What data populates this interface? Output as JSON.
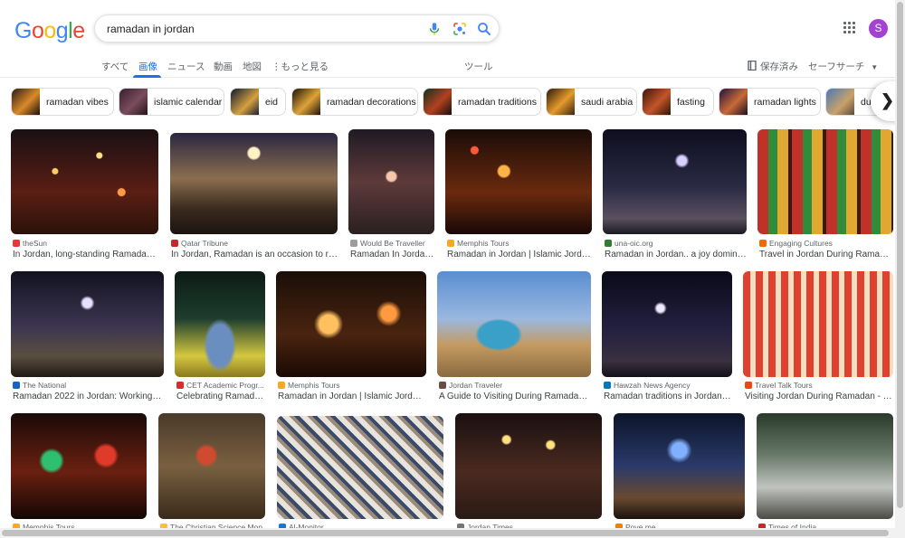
{
  "search": {
    "query": "ramadan in jordan"
  },
  "tabs": {
    "all": "すべて",
    "images": "画像",
    "news": "ニュース",
    "videos": "動画",
    "maps": "地図",
    "more": "もっと見る",
    "tools": "ツール",
    "saved": "保存済み",
    "safesearch": "セーフサーチ"
  },
  "account": {
    "initial": "S"
  },
  "chips": [
    "ramadan vibes",
    "islamic calendar",
    "eid",
    "ramadan decorations",
    "ramadan traditions",
    "saudi arabia",
    "fasting",
    "ramadan lights",
    "duri"
  ],
  "results": [
    {
      "source": "theSun",
      "title": "In Jordan, long-standing Ramadan tr..."
    },
    {
      "source": "Qatar Tribune",
      "title": "In Jordan, Ramadan is an occasion to rev..."
    },
    {
      "source": "Would Be Traveller",
      "title": "Ramadan In Jordan ..."
    },
    {
      "source": "Memphis Tours",
      "title": "Ramadan in Jordan | Islamic Jordan..."
    },
    {
      "source": "una-oic.org",
      "title": "Ramadan in Jordan.. a joy dominat..."
    },
    {
      "source": "Engaging Cultures",
      "title": "Travel in Jordan During Ramadan..."
    },
    {
      "source": "The National",
      "title": "Ramadan 2022 in Jordan: Working ho..."
    },
    {
      "source": "CET Academic Progr...",
      "title": "Celebrating Ramada..."
    },
    {
      "source": "Memphis Tours",
      "title": "Ramadan in Jordan | Islamic Jordan |..."
    },
    {
      "source": "Jordan Traveler",
      "title": "A Guide to Visiting During Ramadan i..."
    },
    {
      "source": "Hawzah News Agency",
      "title": "Ramadan traditions in Jordan, f..."
    },
    {
      "source": "Travel Talk Tours",
      "title": "Visiting Jordan During Ramadan - Co..."
    },
    {
      "source": "Memphis Tours",
      "title": ""
    },
    {
      "source": "The Christian Science Mon...",
      "title": ""
    },
    {
      "source": "Al-Monitor",
      "title": ""
    },
    {
      "source": "Jordan Times",
      "title": ""
    },
    {
      "source": "Pove.me",
      "title": ""
    },
    {
      "source": "Times of India",
      "title": ""
    }
  ],
  "colors": {
    "accent": "#1a73e8",
    "avatar": "#a142d4"
  }
}
